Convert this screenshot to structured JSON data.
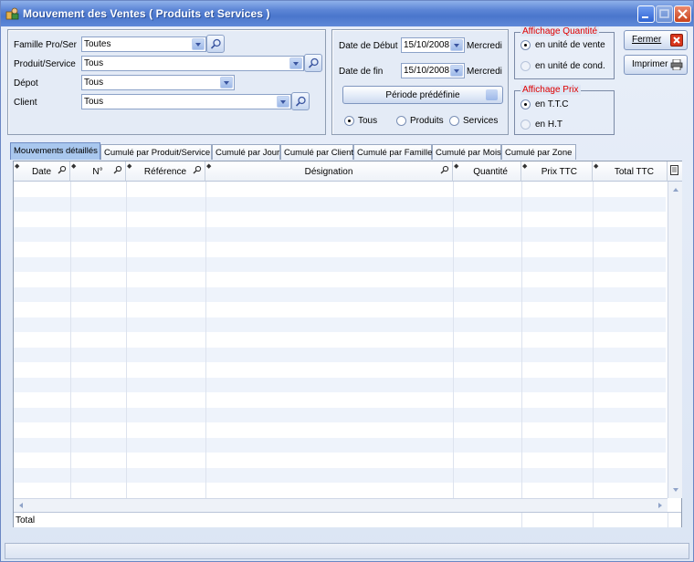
{
  "window": {
    "title": "Mouvement des Ventes  ( Produits et Services )"
  },
  "filters": {
    "famille": {
      "label": "Famille Pro/Ser",
      "value": "Toutes"
    },
    "produit": {
      "label": "Produit/Service",
      "value": "Tous"
    },
    "depot": {
      "label": "Dépot",
      "value": "Tous"
    },
    "client": {
      "label": "Client",
      "value": "Tous"
    }
  },
  "dates": {
    "debut": {
      "label": "Date de Début",
      "value": "15/10/2008",
      "day": "Mercredi"
    },
    "fin": {
      "label": "Date de fin",
      "value": "15/10/2008",
      "day": "Mercredi"
    },
    "periode_label": "Période prédéfinie",
    "types": [
      {
        "label": "Tous",
        "selected": true
      },
      {
        "label": "Produits",
        "selected": false
      },
      {
        "label": "Services",
        "selected": false
      }
    ]
  },
  "affichage_quantite": {
    "legend": "Affichage Quantité",
    "options": [
      {
        "label": "en unité de vente",
        "selected": true
      },
      {
        "label": "en unité de cond.",
        "selected": false
      }
    ]
  },
  "affichage_prix": {
    "legend": "Affichage Prix",
    "options": [
      {
        "label": "en T.T.C",
        "selected": true
      },
      {
        "label": "en H.T",
        "selected": false
      }
    ]
  },
  "buttons": {
    "fermer": "Fermer",
    "imprimer": "Imprimer"
  },
  "tabs": [
    "Mouvements détaillés",
    "Cumulé par Produit/Service",
    "Cumulé par Jour",
    "Cumulé par Client",
    "Cumulé par Famille",
    "Cumulé par Mois",
    "Cumulé par Zone"
  ],
  "columns": [
    "Date",
    "N°",
    "Référence",
    "Désignation",
    "Quantité",
    "Prix TTC",
    "Total TTC"
  ],
  "footer": {
    "total_label": "Total"
  },
  "colors": {
    "title_bar": "#4a76cc",
    "legend_red": "#e00000",
    "row_alt": "#eef3fb"
  }
}
